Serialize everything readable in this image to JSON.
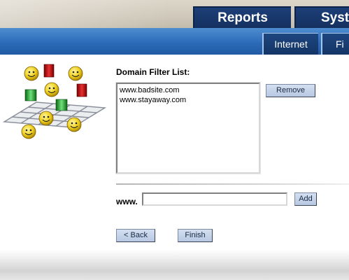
{
  "header": {
    "tabs": [
      {
        "label": "Reports"
      },
      {
        "label": "Syst"
      }
    ]
  },
  "subnav": {
    "tabs": [
      {
        "label": "Internet"
      },
      {
        "label": "Fi"
      }
    ]
  },
  "main": {
    "heading": "Domain Filter List:",
    "domains": [
      "www.badsite.com",
      "www.stayaway.com"
    ],
    "remove_label": "Remove",
    "www_label": "www.",
    "www_value": "",
    "add_label": "Add",
    "back_label": "< Back",
    "finish_label": "Finish"
  },
  "colors": {
    "header_tab": "#14305f",
    "blue_bar": "#2c6bb8",
    "button": "#c4d2ea"
  }
}
